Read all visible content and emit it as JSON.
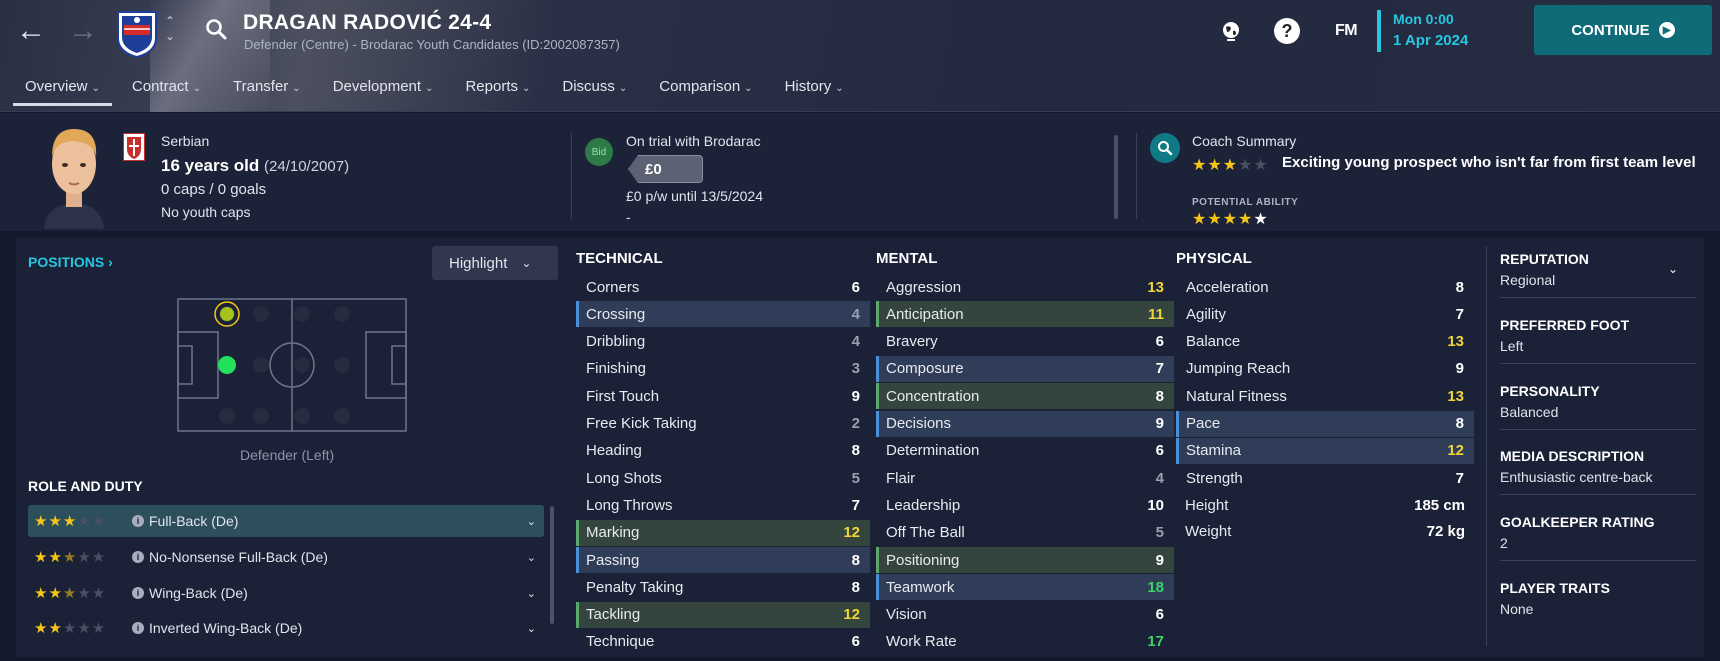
{
  "header": {
    "player_name": "DRAGAN RADOVIĆ 24-4",
    "subtitle": "Defender (Centre) - Brodarac Youth Candidates (ID:2002087357)",
    "time": "Mon 0:00",
    "date": "1 Apr 2024",
    "fm_label": "FM",
    "help_label": "?",
    "continue_label": "CONTINUE"
  },
  "tabs": [
    {
      "label": "Overview"
    },
    {
      "label": "Contract"
    },
    {
      "label": "Transfer"
    },
    {
      "label": "Development"
    },
    {
      "label": "Reports"
    },
    {
      "label": "Discuss"
    },
    {
      "label": "Comparison"
    },
    {
      "label": "History"
    }
  ],
  "profile": {
    "nationality": "Serbian",
    "age": "16 years old",
    "dob": "(24/10/2007)",
    "caps": "0 caps / 0 goals",
    "youth_caps": "No youth caps"
  },
  "contract": {
    "bid_label": "Bid",
    "status": "On trial with Brodarac",
    "value": "£0",
    "wage": "£0 p/w until 13/5/2024",
    "extra": "-"
  },
  "coach": {
    "title": "Coach Summary",
    "description": "Exciting young prospect who isn't far from first team level",
    "current_ability_stars": 3,
    "potential_label": "POTENTIAL ABILITY",
    "potential_ability_stars": 4.5
  },
  "positions": {
    "title": "POSITIONS",
    "highlight_label": "Highlight",
    "pitch_label": "Defender (Left)"
  },
  "roles": {
    "title": "ROLE AND DUTY",
    "items": [
      {
        "name": "Full-Back (De)",
        "stars": 3
      },
      {
        "name": "No-Nonsense Full-Back (De)",
        "stars": 2.5
      },
      {
        "name": "Wing-Back (De)",
        "stars": 2.5
      },
      {
        "name": "Inverted Wing-Back (De)",
        "stars": 2
      }
    ]
  },
  "attributes": {
    "technical_title": "TECHNICAL",
    "mental_title": "MENTAL",
    "physical_title": "PHYSICAL",
    "technical": [
      {
        "name": "Corners",
        "value": "6",
        "hl": "",
        "vc": "w"
      },
      {
        "name": "Crossing",
        "value": "4",
        "hl": "b",
        "vc": "g"
      },
      {
        "name": "Dribbling",
        "value": "4",
        "hl": "",
        "vc": "g"
      },
      {
        "name": "Finishing",
        "value": "3",
        "hl": "",
        "vc": "g"
      },
      {
        "name": "First Touch",
        "value": "9",
        "hl": "",
        "vc": "w"
      },
      {
        "name": "Free Kick Taking",
        "value": "2",
        "hl": "",
        "vc": "g"
      },
      {
        "name": "Heading",
        "value": "8",
        "hl": "",
        "vc": "w"
      },
      {
        "name": "Long Shots",
        "value": "5",
        "hl": "",
        "vc": "g"
      },
      {
        "name": "Long Throws",
        "value": "7",
        "hl": "",
        "vc": "w"
      },
      {
        "name": "Marking",
        "value": "12",
        "hl": "g",
        "vc": "y"
      },
      {
        "name": "Passing",
        "value": "8",
        "hl": "b",
        "vc": "w"
      },
      {
        "name": "Penalty Taking",
        "value": "8",
        "hl": "",
        "vc": "w"
      },
      {
        "name": "Tackling",
        "value": "12",
        "hl": "g",
        "vc": "y"
      },
      {
        "name": "Technique",
        "value": "6",
        "hl": "",
        "vc": "w"
      }
    ],
    "mental": [
      {
        "name": "Aggression",
        "value": "13",
        "hl": "",
        "vc": "y"
      },
      {
        "name": "Anticipation",
        "value": "11",
        "hl": "g",
        "vc": "y"
      },
      {
        "name": "Bravery",
        "value": "6",
        "hl": "",
        "vc": "w"
      },
      {
        "name": "Composure",
        "value": "7",
        "hl": "b",
        "vc": "w"
      },
      {
        "name": "Concentration",
        "value": "8",
        "hl": "g",
        "vc": "w"
      },
      {
        "name": "Decisions",
        "value": "9",
        "hl": "b",
        "vc": "w"
      },
      {
        "name": "Determination",
        "value": "6",
        "hl": "",
        "vc": "w"
      },
      {
        "name": "Flair",
        "value": "4",
        "hl": "",
        "vc": "g"
      },
      {
        "name": "Leadership",
        "value": "10",
        "hl": "",
        "vc": "w"
      },
      {
        "name": "Off The Ball",
        "value": "5",
        "hl": "",
        "vc": "g"
      },
      {
        "name": "Positioning",
        "value": "9",
        "hl": "g",
        "vc": "w"
      },
      {
        "name": "Teamwork",
        "value": "18",
        "hl": "b",
        "vc": "gr"
      },
      {
        "name": "Vision",
        "value": "6",
        "hl": "",
        "vc": "w"
      },
      {
        "name": "Work Rate",
        "value": "17",
        "hl": "",
        "vc": "gr"
      }
    ],
    "physical": [
      {
        "name": "Acceleration",
        "value": "8",
        "hl": "",
        "vc": "w"
      },
      {
        "name": "Agility",
        "value": "7",
        "hl": "",
        "vc": "w"
      },
      {
        "name": "Balance",
        "value": "13",
        "hl": "",
        "vc": "y"
      },
      {
        "name": "Jumping Reach",
        "value": "9",
        "hl": "",
        "vc": "w"
      },
      {
        "name": "Natural Fitness",
        "value": "13",
        "hl": "",
        "vc": "y"
      },
      {
        "name": "Pace",
        "value": "8",
        "hl": "b",
        "vc": "w"
      },
      {
        "name": "Stamina",
        "value": "12",
        "hl": "b",
        "vc": "y"
      },
      {
        "name": "Strength",
        "value": "7",
        "hl": "",
        "vc": "w"
      }
    ],
    "height_label": "Height",
    "height": "185 cm",
    "weight_label": "Weight",
    "weight": "72 kg"
  },
  "side": [
    {
      "label": "REPUTATION",
      "value": "Regional"
    },
    {
      "label": "PREFERRED FOOT",
      "value": "Left"
    },
    {
      "label": "PERSONALITY",
      "value": "Balanced"
    },
    {
      "label": "MEDIA DESCRIPTION",
      "value": "Enthusiastic centre-back"
    },
    {
      "label": "GOALKEEPER RATING",
      "value": "2"
    },
    {
      "label": "PLAYER TRAITS",
      "value": "None"
    }
  ],
  "colors": {
    "accent": "#27c7e0",
    "continue_bg": "#0f6b78",
    "star": "#f5c518",
    "attr_good": "#f0d53a",
    "attr_great": "#3ed36a"
  }
}
